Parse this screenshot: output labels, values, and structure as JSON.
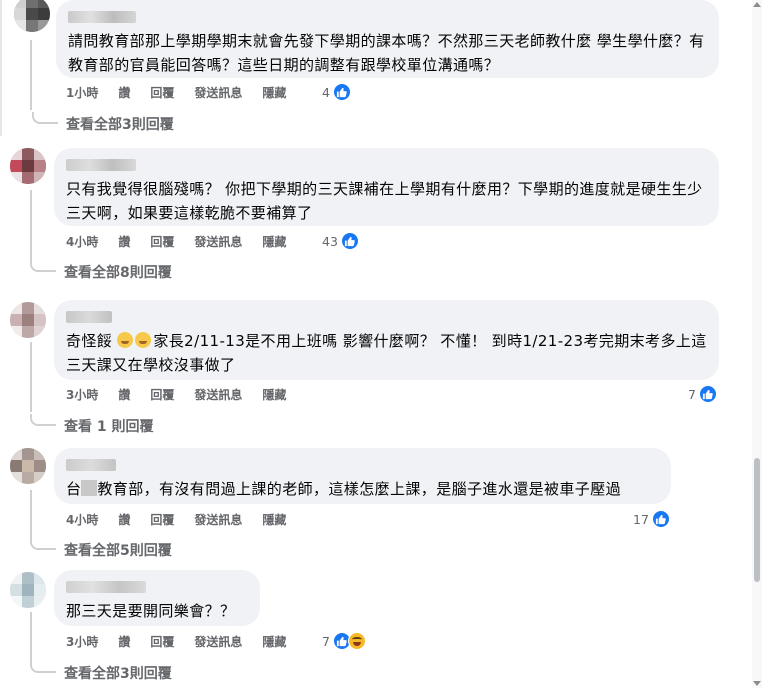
{
  "colors": {
    "accent": "#1877f2",
    "bubble_bg": "#f0f2f5",
    "meta_text": "#65676b"
  },
  "actions": {
    "like": "讚",
    "reply": "回覆",
    "send_message": "發送訊息",
    "hide": "隱藏"
  },
  "comments": [
    {
      "text": "請問教育部那上學期學期末就會先發下學期的課本嗎？不然那三天老師教什麼 學生學什麼？有教育部的官員能回答嗎？這些日期的調整有跟學校單位溝通嗎？",
      "time": "1小時",
      "reactions": "4",
      "reaction_icons": [
        "like-icon"
      ],
      "replies_label": "查看全部3則回覆"
    },
    {
      "text": "只有我覺得很腦殘嗎？ 你把下學期的三天課補在上學期有什麼用？下學期的進度就是硬生生少三天啊，如果要這樣乾脆不要補算了",
      "time": "4小時",
      "reactions": "43",
      "reaction_icons": [
        "like-icon"
      ],
      "replies_label": "查看全部8則回覆"
    },
    {
      "text_parts": {
        "prefix": "奇怪餒 ",
        "suffix": "家長2/11-13是不用上班嗎 影響什麼啊？ 不懂！ 到時1/21-23考完期末考多上這三天課又在學校沒事做了"
      },
      "time": "3小時",
      "reactions": "7",
      "reaction_icons": [
        "like-icon"
      ],
      "replies_label": "查看 1 則回覆"
    },
    {
      "text_parts": {
        "prefix": "台",
        "suffix": "教育部，有沒有問過上課的老師，這樣怎麼上課，是腦子進水還是被車子壓過"
      },
      "time": "4小時",
      "reactions": "17",
      "reaction_icons": [
        "like-icon"
      ],
      "replies_label": "查看全部5則回覆"
    },
    {
      "text": "那三天是要開同樂會？？",
      "time": "3小時",
      "reactions": "7",
      "reaction_icons": [
        "like-icon",
        "haha-icon"
      ],
      "replies_label": "查看全部3則回覆"
    }
  ]
}
